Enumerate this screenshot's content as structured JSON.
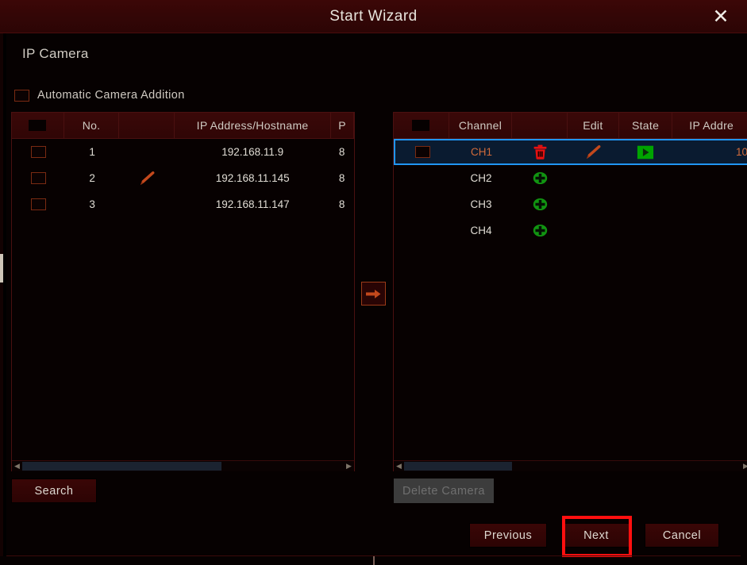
{
  "window": {
    "title": "Start Wizard",
    "close_icon": "close-icon",
    "page_title": "IP Camera"
  },
  "auto_add": {
    "label": "Automatic Camera Addition",
    "checked": false
  },
  "left_panel": {
    "columns": [
      "",
      "No.",
      "",
      "IP Address/Hostname",
      "P"
    ],
    "rows": [
      {
        "no": "1",
        "edit_icon": "",
        "ip": "192.168.11.9",
        "port": "8"
      },
      {
        "no": "2",
        "edit_icon": "pencil-icon",
        "ip": "192.168.11.145",
        "port": "8"
      },
      {
        "no": "3",
        "edit_icon": "",
        "ip": "192.168.11.147",
        "port": "8"
      }
    ],
    "search_label": "Search",
    "scroll_thumb_pct": 62
  },
  "transfer": {
    "icon": "arrow-right-icon"
  },
  "right_panel": {
    "columns": [
      "",
      "Channel",
      "",
      "Edit",
      "State",
      "IP Addre"
    ],
    "rows": [
      {
        "channel": "CH1",
        "action_icon": "trash-icon",
        "edit_icon": "pencil-icon",
        "state_icon": "play-icon",
        "ip": "10",
        "selected": true
      },
      {
        "channel": "CH2",
        "action_icon": "plus-icon",
        "edit_icon": "",
        "state_icon": "",
        "ip": "",
        "selected": false
      },
      {
        "channel": "CH3",
        "action_icon": "plus-icon",
        "edit_icon": "",
        "state_icon": "",
        "ip": "",
        "selected": false
      },
      {
        "channel": "CH4",
        "action_icon": "plus-icon",
        "edit_icon": "",
        "state_icon": "",
        "ip": "",
        "selected": false
      }
    ],
    "delete_label": "Delete Camera",
    "delete_enabled": false,
    "scroll_thumb_pct": 32
  },
  "footer": {
    "previous_label": "Previous",
    "next_label": "Next",
    "cancel_label": "Cancel",
    "highlighted_button": "Next"
  },
  "colors": {
    "titlebar": "#340606",
    "panel_bg": "#060101",
    "header_row": "#340707",
    "border": "#4a1010",
    "accent_red": "#9a3a18",
    "selection_border": "#2196f3",
    "selection_bg": "#0a1b30",
    "selected_text": "#d06a3a",
    "green": "#00a000",
    "trash_red": "#e81010",
    "highlight_red": "#ff0f0f",
    "text": "#cfcac2"
  }
}
